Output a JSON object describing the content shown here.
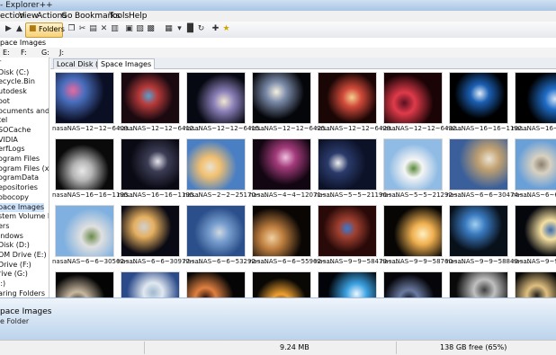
{
  "window": {
    "title": "- Explorer++"
  },
  "menu": [
    "ection",
    "View",
    "Actions",
    "Go",
    "Bookmarks",
    "Tools",
    "Help"
  ],
  "toolbar": {
    "folders_label": "Folders"
  },
  "address": {
    "path": "pace Images"
  },
  "drives": [
    "E:",
    "F:",
    "G:",
    "J:"
  ],
  "tree": {
    "items": [
      "r",
      "Disk (C:)",
      "ecycle.Bin",
      "utodesk",
      "oot",
      "ocuments and Set",
      "tel",
      "SOCache",
      "VIDIA",
      "erfLogs",
      "ogram Files",
      "ogram Files (x86)",
      "ogramData",
      "epositories",
      "obocopy",
      "pace Images",
      "stem Volume Info",
      "ers",
      "indows",
      "Disk (D:)",
      "OM Drive (E:)",
      "Drive (F:)",
      "rive (G:)",
      "J:)",
      "aring Folders"
    ],
    "selected_index": 15
  },
  "tabs": [
    {
      "label": "Local Disk (C:)",
      "active": false
    },
    {
      "label": "Space Images",
      "active": true
    }
  ],
  "thumbnails": [
    {
      "name": "nasaNAS~12~12~6409...",
      "colors": [
        "#0b0f24",
        "#4a6fbf",
        "#e86aa0"
      ]
    },
    {
      "name": "nasaNAS~12~12~6412...",
      "colors": [
        "#1a0a10",
        "#b83a3a",
        "#5aa0d0"
      ]
    },
    {
      "name": "nasaNAS~12~12~6415...",
      "colors": [
        "#070912",
        "#8a7fb8",
        "#f0e6d0"
      ]
    },
    {
      "name": "nasaNAS~12~12~6425...",
      "colors": [
        "#05060a",
        "#7a8aa8",
        "#f5f0e0"
      ]
    },
    {
      "name": "nasaNAS~12~12~6429...",
      "colors": [
        "#1a0605",
        "#d24a3a",
        "#f5d090"
      ]
    },
    {
      "name": "nasaNAS~12~12~6432...",
      "colors": [
        "#1b0406",
        "#e03a4a",
        "#5a1020"
      ]
    },
    {
      "name": "nasaNAS~16~16~1192...",
      "colors": [
        "#000000",
        "#1b5fb3",
        "#e0ecf8"
      ]
    },
    {
      "name": "nasaNAS~16~16~1195...",
      "colors": [
        "#000000",
        "#1f6cc7",
        "#d8e6f5"
      ]
    },
    {
      "name": "nasaNAS~16~16~1195...",
      "colors": [
        "#0a0a0a",
        "#b5b5b5",
        "#e8e8e8"
      ]
    },
    {
      "name": "nasaNAS~16~16~1195...",
      "colors": [
        "#0a0a14",
        "#3c3c55",
        "#e6e6ee"
      ]
    },
    {
      "name": "nasaNAS~2~2~25170~...",
      "colors": [
        "#4a7fc4",
        "#f2c070",
        "#e9e2d0"
      ]
    },
    {
      "name": "nasaNAS~4~4~12071~...",
      "colors": [
        "#120612",
        "#a23a7a",
        "#f0c0e0"
      ]
    },
    {
      "name": "nasaNAS~5~5~21196~...",
      "colors": [
        "#0c1228",
        "#2a3a6a",
        "#f0f0f0"
      ]
    },
    {
      "name": "nasaNAS~5~5~21292~...",
      "colors": [
        "#8fbbe4",
        "#f5f5f5",
        "#5a8a3a"
      ]
    },
    {
      "name": "nasaNAS~6~6~30474~...",
      "colors": [
        "#3a5f9a",
        "#c0a070",
        "#ece3d4"
      ]
    },
    {
      "name": "nasaNAS~6~6~30...",
      "colors": [
        "#6aa0d8",
        "#d8d0c0",
        "#8a8070"
      ]
    },
    {
      "name": "nasaNAS~6~6~30562~...",
      "colors": [
        "#7fb0e0",
        "#e0e0e0",
        "#6a8a4a"
      ]
    },
    {
      "name": "nasaNAS~6~6~30977~...",
      "colors": [
        "#0a0a14",
        "#e6b060",
        "#d0d0d0"
      ]
    },
    {
      "name": "nasaNAS~6~6~53292~...",
      "colors": [
        "#2a4f8a",
        "#7aa0d0",
        "#d0d8e0"
      ]
    },
    {
      "name": "nasaNAS~6~6~55962~...",
      "colors": [
        "#0a0604",
        "#c08040",
        "#f0d0a0"
      ]
    },
    {
      "name": "nasaNAS~9~9~58479~...",
      "colors": [
        "#2a0a08",
        "#a04030",
        "#3a7ad0"
      ]
    },
    {
      "name": "nasaNAS~9~9~58760~...",
      "colors": [
        "#070604",
        "#f0b050",
        "#fff0c0"
      ]
    },
    {
      "name": "nasaNAS~9~9~58849~...",
      "colors": [
        "#08101a",
        "#3a7ac0",
        "#a0d0f0"
      ]
    },
    {
      "name": "nasaNAS~9~9~58...",
      "colors": [
        "#05070d",
        "#f5e0a0",
        "#3a6ab0"
      ]
    },
    {
      "name": "",
      "colors": [
        "#040404",
        "#c8b8a0",
        "#2a2a2a"
      ]
    },
    {
      "name": "",
      "colors": [
        "#2a4a8a",
        "#e0e8f0",
        "#a0b8d0"
      ]
    },
    {
      "name": "",
      "colors": [
        "#050505",
        "#e08040",
        "#301008"
      ]
    },
    {
      "name": "",
      "colors": [
        "#0a0805",
        "#f0a030",
        "#402010"
      ]
    },
    {
      "name": "",
      "colors": [
        "#02040a",
        "#3aa0e0",
        "#f0f8ff"
      ]
    },
    {
      "name": "",
      "colors": [
        "#05050a",
        "#6a7aa0",
        "#101020"
      ]
    },
    {
      "name": "",
      "colors": [
        "#0a0a0a",
        "#c0c0c0",
        "#404040"
      ]
    },
    {
      "name": "",
      "colors": [
        "#050505",
        "#e0c080",
        "#202020"
      ]
    }
  ],
  "details": {
    "name": "pace Images",
    "kind": "e Folder"
  },
  "status": {
    "size": "9.24 MB",
    "free": "138 GB free (65%)"
  }
}
